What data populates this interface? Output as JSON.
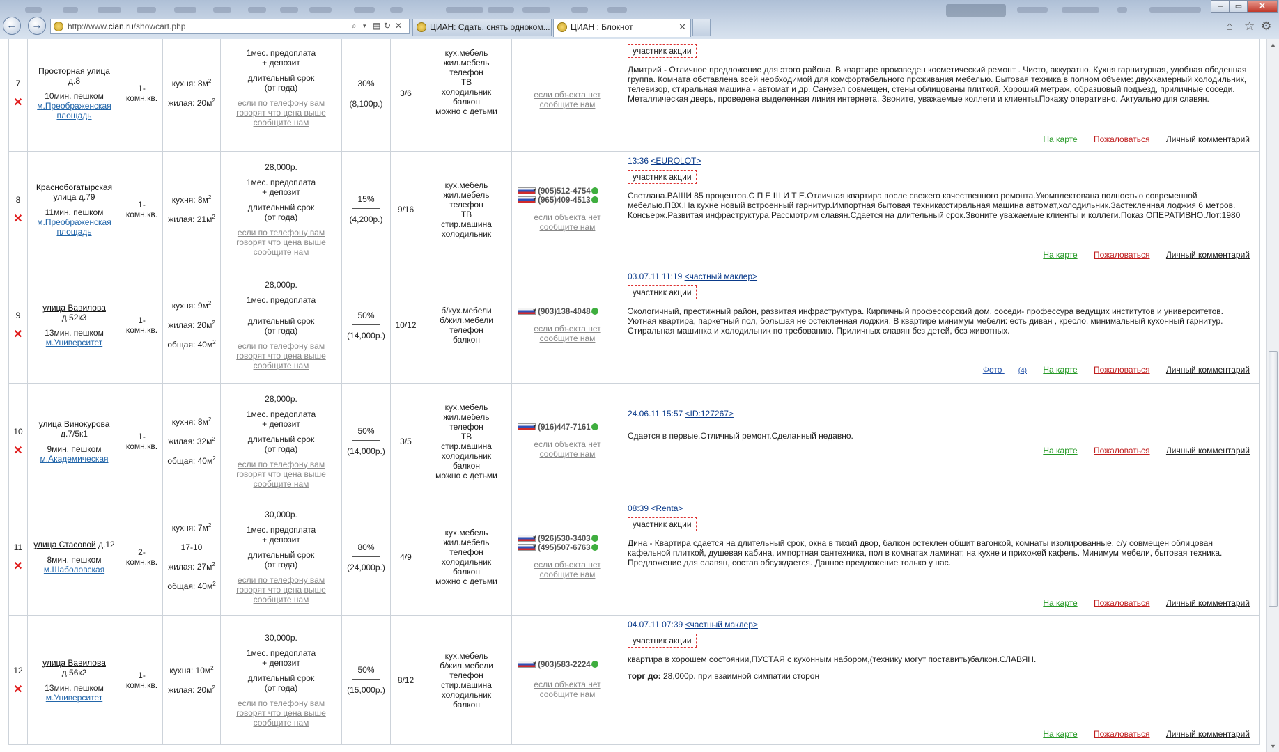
{
  "browser": {
    "url_prefix": "http://www.",
    "url_domain": "cian.ru",
    "url_path": "/showcart.php",
    "tabs": [
      {
        "title": "ЦИАН: Сдать, снять одноком..."
      },
      {
        "title": "ЦИАН : Блокнот"
      }
    ],
    "close_glyph": "✕"
  },
  "labels": {
    "na_karte": "На карте",
    "pozhalovatsya": "Пожаловаться",
    "lichny": "Личный комментарий",
    "uchastnik": "участник акции",
    "esli_net_1": "если объекта нет",
    "esli_net_2": "сообщите нам",
    "hint_1": "если по телефону вам",
    "hint_2": "говорят что цена выше",
    "hint_3": "сообщите нам",
    "predoplata": "1мес. предоплата",
    "depozit": "+ депозит",
    "srok": "длительный срок",
    "ot_goda": "(от года)",
    "komn_1": "1-",
    "komn_2": "2-",
    "komn_kv": "комн.кв.",
    "foto": "Фото",
    "foto_count": "(4)",
    "torg_label": "торг до:",
    "torg_text": "28,000р. при взаимной симпатии сторон"
  },
  "rows": [
    {
      "num": "7",
      "street": "Просторная улица",
      "house": "д.8",
      "walk": "10мин. пешком",
      "metro_1": "м.Преображенская",
      "metro_2": "площадь",
      "kitchen": "кухня: 8м",
      "living": "жилая: 20м",
      "percent": "30%",
      "commission": "(8,100р.)",
      "floor": "3/6",
      "amenities": [
        "кух.мебель",
        "жил.мебель",
        "телефон",
        "ТВ",
        "холодильник",
        "балкон",
        "можно с детьми"
      ],
      "desc": "Дмитрий - Отличное предложение для этого района. В квартире произведен косметический ремонт . Чисто, аккуратно. Кухня гарнитурная, удобная обеденная группа. Комната обставлена всей необходимой для комфортабельного проживания мебелью. Бытовая техника в полном объеме: двухкамерный холодильник, телевизор, стиральная машина - автомат и др. Санузел совмещен, стены облицованы плиткой. Хороший метраж, образцовый подъезд, приличные соседи. Металлическая дверь, проведена выделенная линия интернета. Звоните, уважаемые коллеги и клиенты.Покажу оперативно. Актуально для славян."
    },
    {
      "num": "8",
      "street_1": "Краснобогатырская",
      "street_2": "улица",
      "house": "д.79",
      "walk": "11мин. пешком",
      "metro_1": "м.Преображенская",
      "metro_2": "площадь",
      "price": "28,000р.",
      "kitchen": "кухня: 8м",
      "living": "жилая: 21м",
      "percent": "15%",
      "commission": "(4,200р.)",
      "floor": "9/16",
      "amenities": [
        "кух.мебель",
        "жил.мебель",
        "телефон",
        "ТВ",
        "стир.машина",
        "холодильник"
      ],
      "phones": [
        "(905)512-4754",
        "(965)409-4513"
      ],
      "date": "13:36",
      "agency": "<EUROLOT>",
      "desc": "Светлана.ВАШИ 85 процентов.С П Е Ш И Т Е.Отличная квартира после свежего качественного ремонта.Укомплектована полностью современной мебелью.ПВХ.На кухне новый встроенный гарнитур.Импортная бытовая техника:стиральная машина автомат,холодильник.Застекленная лоджия 6 метров. Консьерж.Развитая инфраструктура.Рассмотрим славян.Сдается на длительный срок.Звоните уважаемые клиенты и коллеги.Показ ОПЕРАТИВНО.Лот:1980"
    },
    {
      "num": "9",
      "street": "улица Вавилова",
      "house": "д.52к3",
      "walk": "13мин. пешком",
      "metro_1": "м.Университет",
      "price": "28,000р.",
      "kitchen": "кухня: 9м",
      "living": "жилая: 20м",
      "total": "общая: 40м",
      "percent": "50%",
      "commission": "(14,000р.)",
      "floor": "10/12",
      "amenities": [
        "б/кух.мебели",
        "б/жил.мебели",
        "телефон",
        "балкон"
      ],
      "phones": [
        "(903)138-4048"
      ],
      "date": "03.07.11 11:19",
      "agency": "<частный маклер>",
      "desc": "Экологичный, престижный район, развитая инфраструктура. Кирпичный профессорский дом, соседи- профессура ведущих институтов и университетов. Уютная квартира, паркетный пол, большая не остекленная лоджия. В квартире минимум мебели: есть диван , кресло, минимальный кухонный гарнитур. Стиральная машинка и холодильник по требованию. Приличных славян без детей, без животных."
    },
    {
      "num": "10",
      "street": "улица Винокурова",
      "house": "д.7/5к1",
      "walk": "9мин. пешком",
      "metro_1": "м.Академическая",
      "price": "28,000р.",
      "kitchen": "кухня: 8м",
      "living": "жилая: 32м",
      "total": "общая: 40м",
      "percent": "50%",
      "commission": "(14,000р.)",
      "floor": "3/5",
      "amenities": [
        "кух.мебель",
        "жил.мебель",
        "телефон",
        "ТВ",
        "стир.машина",
        "холодильник",
        "балкон",
        "можно с детьми"
      ],
      "phones": [
        "(916)447-7161"
      ],
      "date": "24.06.11 15:57",
      "agency": "<ID:127267>",
      "desc": "Сдается в первые.Отличный ремонт.Сделанный недавно."
    },
    {
      "num": "11",
      "street": "улица Стасовой",
      "house": "д.12",
      "walk": "8мин. пешком",
      "metro_1": "м.Шаболовская",
      "price": "30,000р.",
      "kitchen": "кухня: 7м",
      "size": "17-10",
      "living": "жилая: 27м",
      "total": "общая: 40м",
      "percent": "80%",
      "commission": "(24,000р.)",
      "floor": "4/9",
      "amenities": [
        "кух.мебель",
        "жил.мебель",
        "телефон",
        "холодильник",
        "балкон",
        "можно с детьми"
      ],
      "phones": [
        "(926)530-3403",
        "(495)507-6763"
      ],
      "date": "08:39",
      "agency": "<Renta>",
      "desc": "Дина - Квартира сдается на длительный срок, окна в тихий двор, балкон остеклен обшит вагонкой, комнаты изолированные, с/у совмещен облицован кафельной плиткой, душевая кабина, импортная сантехника, пол в комнатах ламинат, на кухне и прихожей кафель. Минимум мебели, бытовая техника. Предложение для славян, состав обсуждается. Данное предложение только у нас."
    },
    {
      "num": "12",
      "street": "улица Вавилова",
      "house": "д.56к2",
      "walk": "13мин. пешком",
      "metro_1": "м.Университет",
      "price": "30,000р.",
      "kitchen": "кухня: 10м",
      "living": "жилая: 20м",
      "percent": "50%",
      "commission": "(15,000р.)",
      "floor": "8/12",
      "amenities": [
        "кух.мебель",
        "б/жил.мебели",
        "телефон",
        "стир.машина",
        "холодильник",
        "балкон"
      ],
      "phones": [
        "(903)583-2224"
      ],
      "date": "04.07.11 07:39",
      "agency": "<частный маклер>",
      "desc": "квартира в хорошем состоянии,ПУСТАЯ с кухонным набором,(технику могут поставить)балкон.СЛАВЯН."
    }
  ],
  "colors": {
    "link_green": "#279a27",
    "link_red": "#c01f1f",
    "metro_blue": "#2266aa",
    "badge_border": "#dd3333"
  }
}
